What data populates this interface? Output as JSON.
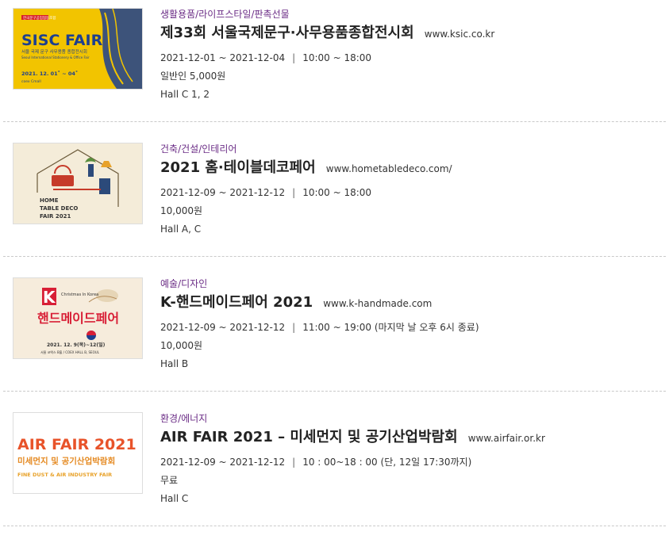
{
  "events": [
    {
      "category": "생활용품/라이프스타일/판촉선물",
      "title": "제33회 서울국제문구·사무용품종합전시회",
      "url": "www.ksic.co.kr",
      "dates": "2021-12-01 ~ 2021-12-04",
      "hours": "10:00 ~ 18:00",
      "price": "일반인 5,000원",
      "hall": "Hall C 1, 2",
      "poster": {
        "tag": "한국문구공업협동조합",
        "name": "SISC FAIR",
        "subtitle": "서울 국제 문구 사무용품 종합전시회",
        "english": "Seoul International Stationery & Office Fair",
        "date": "2021. 12. 01˚ ~ 04˚",
        "venue": "coex Cmall",
        "bg_color": "#f2c400"
      }
    },
    {
      "category": "건축/건설/인테리어",
      "title": "2021 홈·테이블데코페어",
      "url": "www.hometabledeco.com/",
      "dates": "2021-12-09 ~ 2021-12-12",
      "hours": "10:00 ~ 18:00",
      "price": "10,000원",
      "hall": "Hall A, C",
      "poster": {
        "line1": "HOME",
        "line2": "TABLE DECO",
        "line3": "FAIR 2021",
        "bg_color": "#f4ecd9"
      }
    },
    {
      "category": "예술/디자인",
      "title": "K-핸드메이드페어 2021",
      "url": "www.k-handmade.com",
      "dates": "2021-12-09 ~ 2021-12-12",
      "hours": "11:00 ~ 19:00 (마지막 날 오후 6시 종료)",
      "price": "10,000원",
      "hall": "Hall B",
      "poster": {
        "letter": "K",
        "name": "핸드메이드페어",
        "christmas": "Christmas In Korea",
        "date": "2021. 12. 9(목)~12(일)",
        "venue": "서울 코엑스 B홀 / COEX HALL B, SEOUL",
        "bg_color": "#f6ecdc"
      }
    },
    {
      "category": "환경/에너지",
      "title": "AIR FAIR 2021 – 미세먼지 및 공기산업박람회",
      "url": "www.airfair.or.kr",
      "dates": "2021-12-09 ~ 2021-12-12",
      "hours": "10 : 00~18 : 00 (단, 12일 17:30까지)",
      "price": "무료",
      "hall": "Hall C",
      "poster": {
        "name": "AIR FAIR 2021",
        "korean": "미세먼지 및 공기산업박람회",
        "english": "FINE DUST & AIR INDUSTRY FAIR",
        "bg_color": "#ffffff"
      }
    }
  ]
}
